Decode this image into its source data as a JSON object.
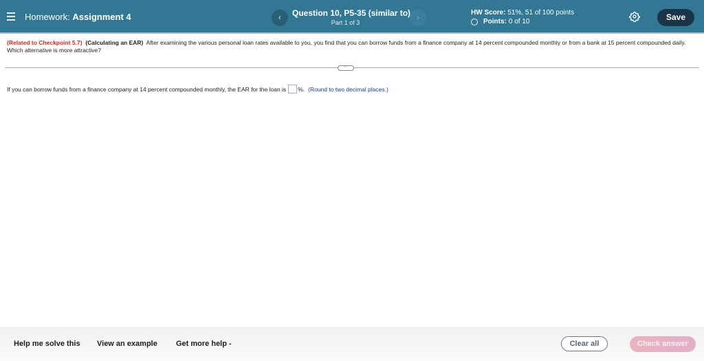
{
  "header": {
    "menu_icon": "hamburger-menu-icon",
    "homework_prefix": "Homework:",
    "assignment_name": "Assignment 4",
    "prev_label": "‹",
    "next_label": "›",
    "question_title": "Question 10, P5-35 (similar to)",
    "part": "Part 1 of 3",
    "score_label": "HW Score:",
    "score_value": "51%, 51 of 100 points",
    "points_label": "Points:",
    "points_value": "0 of 10",
    "settings_icon": "gear-icon",
    "save_label": "Save"
  },
  "problem": {
    "related": "(Related to Checkpoint 5.7)",
    "topic": "(Calculating an EAR)",
    "text": "After examining the various personal loan rates available to you, you find that you can borrow funds from a finance company at 14 percent compounded monthly or from a bank at 15 percent compounded daily.  Which alternative is more attractive?",
    "expand_label": "⋯"
  },
  "question": {
    "prefix": "If you can borrow funds from a finance company at 14 percent compounded monthly, the EAR for the loan is",
    "answer_value": "",
    "suffix": "%.",
    "hint": "(Round to two decimal places.)"
  },
  "footer": {
    "help_solve": "Help me solve this",
    "view_example": "View an example",
    "more_help": "Get more help -",
    "clear_all": "Clear all",
    "check_answer": "Check answer"
  },
  "colors": {
    "header_bg": "#327794",
    "save_bg": "#1c3447",
    "related_red": "#d0281f",
    "hint_blue": "#1a3e8c",
    "check_answer_pink": "#e9b3bf"
  }
}
